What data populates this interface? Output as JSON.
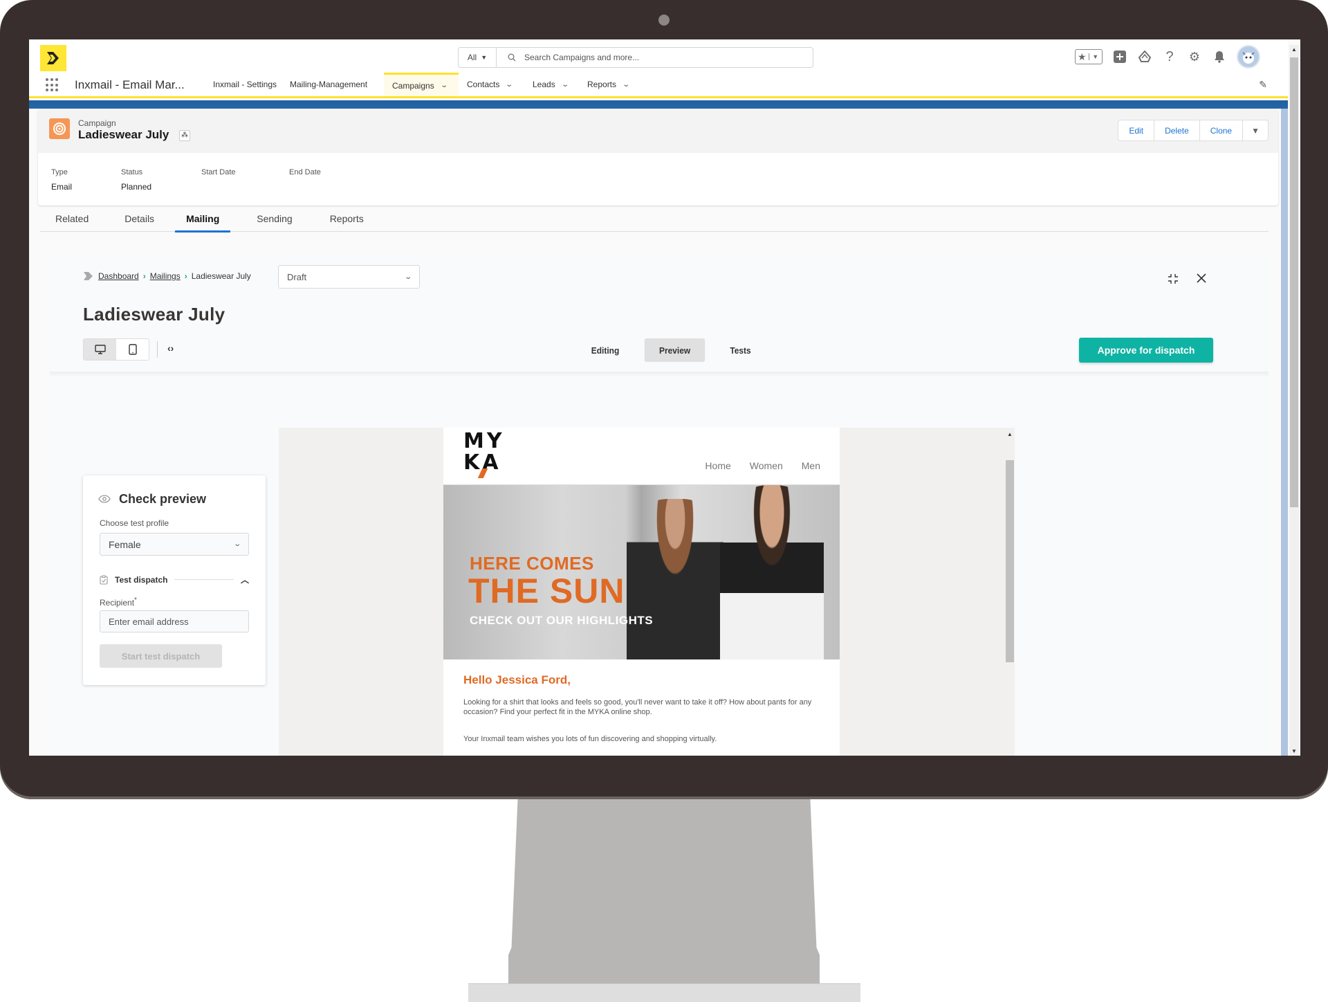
{
  "global_header": {
    "search_scope": "All",
    "search_placeholder": "Search Campaigns and more...",
    "icons": [
      "favorites-star-icon",
      "add-icon",
      "trailhead-icon",
      "help-icon",
      "settings-gear-icon",
      "notifications-bell-icon",
      "user-avatar"
    ]
  },
  "nav": {
    "app_name": "Inxmail - Email Mar...",
    "items": [
      {
        "label": "Inxmail - Settings",
        "has_dropdown": false,
        "active": false
      },
      {
        "label": "Mailing-Management",
        "has_dropdown": false,
        "active": false
      },
      {
        "label": "Campaigns",
        "has_dropdown": true,
        "active": true
      },
      {
        "label": "Contacts",
        "has_dropdown": true,
        "active": false
      },
      {
        "label": "Leads",
        "has_dropdown": true,
        "active": false
      },
      {
        "label": "Reports",
        "has_dropdown": true,
        "active": false
      }
    ]
  },
  "record": {
    "object_label": "Campaign",
    "title": "Ladieswear July",
    "actions": [
      "Edit",
      "Delete",
      "Clone"
    ],
    "fields": [
      {
        "label": "Type",
        "value": "Email"
      },
      {
        "label": "Status",
        "value": "Planned"
      },
      {
        "label": "Start Date",
        "value": ""
      },
      {
        "label": "End Date",
        "value": ""
      }
    ],
    "tabs": [
      {
        "label": "Related",
        "active": false
      },
      {
        "label": "Details",
        "active": false
      },
      {
        "label": "Mailing",
        "active": true
      },
      {
        "label": "Sending",
        "active": false
      },
      {
        "label": "Reports",
        "active": false
      }
    ]
  },
  "mailing": {
    "breadcrumb": [
      "Dashboard",
      "Mailings",
      "Ladieswear July"
    ],
    "status_select": "Draft",
    "title": "Ladieswear July",
    "device_options": [
      "desktop",
      "mobile"
    ],
    "active_device": "desktop",
    "mode_tabs": [
      {
        "label": "Editing",
        "active": false
      },
      {
        "label": "Preview",
        "active": true
      },
      {
        "label": "Tests",
        "active": false
      }
    ],
    "approve_label": "Approve for dispatch"
  },
  "check_preview": {
    "title": "Check preview",
    "profile_label": "Choose test profile",
    "profile_value": "Female",
    "test_dispatch_heading": "Test dispatch",
    "recipient_label": "Recipient",
    "recipient_required": "*",
    "recipient_placeholder": "Enter email address",
    "start_button": "Start test dispatch"
  },
  "email_preview": {
    "logo_line1": "MY",
    "logo_line2": "KA",
    "nav": [
      "Home",
      "Women",
      "Men"
    ],
    "hero_line1": "HERE COMES",
    "hero_line2": "THE SUN",
    "hero_line3": "CHECK OUT OUR HIGHLIGHTS",
    "greeting": "Hello Jessica Ford,",
    "paragraph1": "Looking for a shirt that looks and feels so good, you'll never want to take it off? How about pants for any occasion? Find your perfect fit in the MYKA online shop.",
    "paragraph2": "Your Inxmail team wishes you lots of fun discovering and shopping virtually.",
    "accent_color": "#e06a24"
  },
  "colors": {
    "brand_yellow": "#ffe534",
    "approve_teal": "#0fb3a4",
    "link_blue": "#1b74cf",
    "campaign_orange": "#f49756"
  }
}
